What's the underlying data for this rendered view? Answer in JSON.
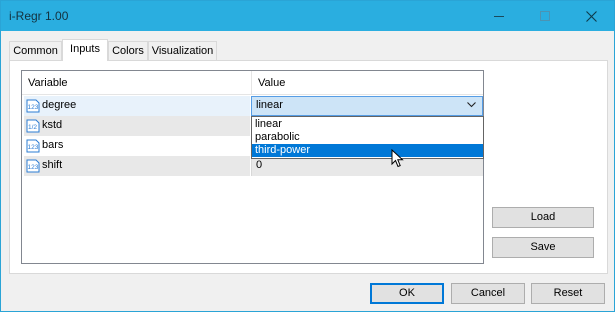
{
  "window": {
    "title": "i-Regr 1.00"
  },
  "tabs": [
    {
      "label": "Common",
      "active": false
    },
    {
      "label": "Inputs",
      "active": true
    },
    {
      "label": "Colors",
      "active": false
    },
    {
      "label": "Visualization",
      "active": false
    }
  ],
  "grid": {
    "headers": {
      "variable": "Variable",
      "value": "Value"
    },
    "rows": [
      {
        "icon": "integer-type-icon",
        "icon_text": "123",
        "name": "degree",
        "value": "linear"
      },
      {
        "icon": "fraction-type-icon",
        "icon_text": "1/2",
        "name": "kstd",
        "value": ""
      },
      {
        "icon": "integer-type-icon",
        "icon_text": "123",
        "name": "bars",
        "value": ""
      },
      {
        "icon": "integer-type-icon",
        "icon_text": "123",
        "name": "shift",
        "value": "0"
      }
    ]
  },
  "combo": {
    "selected": "linear",
    "options": [
      "linear",
      "parabolic",
      "third-power"
    ],
    "highlighted": "third-power"
  },
  "side_buttons": {
    "load": "Load",
    "save": "Save"
  },
  "footer_buttons": {
    "ok": "OK",
    "cancel": "Cancel",
    "reset": "Reset"
  },
  "colors": {
    "titlebar": "#2aaee0",
    "accent": "#0078d7",
    "combo_fill": "#cde4f7"
  }
}
